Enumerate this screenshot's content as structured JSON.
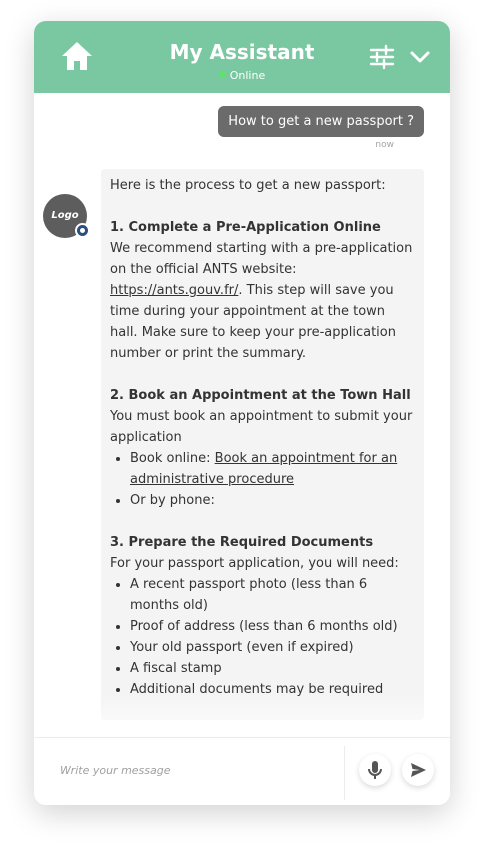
{
  "header": {
    "title": "My  Assistant",
    "status": "Online",
    "colors": {
      "header_bg": "#7ac8a1",
      "status_dot": "#5fe26a"
    },
    "icons": [
      "home-icon",
      "settings-sliders-icon",
      "chevron-down-icon"
    ]
  },
  "conversation": {
    "user_message": "How to get a new passport ?",
    "user_time": "now",
    "avatar_text": "Logo",
    "bot": {
      "intro": "Here is the process to get a new passport:",
      "s1_title": "1. Complete a Pre-Application Online",
      "s1_text_a": "We recommend starting with a pre-application on the official ANTS website: ",
      "s1_link": "https://ants.gouv.fr/",
      "s1_text_b": ". This step will save you time during your appointment at the town hall. Make sure to keep your pre-application number or print the summary.",
      "s2_title": "2. Book an Appointment at the Town Hall",
      "s2_text": "You must book an appointment to submit your application",
      "s2_item1_prefix": "Book online: ",
      "s2_item1_link": "Book an appointment for an administrative procedure",
      "s2_item2": "Or by phone:",
      "s3_title": "3. Prepare the Required Documents",
      "s3_text": "For your passport application, you will need:",
      "s3_items": [
        "A recent passport photo (less than 6 months old)",
        "Proof of address (less than 6 months old)",
        "Your old passport (even if expired)",
        "A fiscal stamp",
        "Additional documents may be required"
      ]
    }
  },
  "footer": {
    "placeholder": "Write your message",
    "icons": [
      "microphone-icon",
      "send-icon"
    ]
  }
}
